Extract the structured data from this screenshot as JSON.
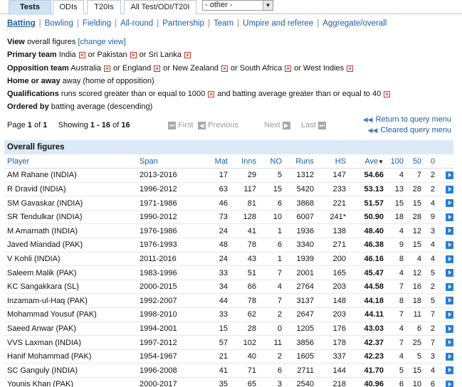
{
  "format_tabs": [
    "Tests",
    "ODIs",
    "T20Is",
    "All Test/ODI/T20I"
  ],
  "other_select": "- other -",
  "subnav": [
    "Batting",
    "Bowling",
    "Fielding",
    "All-round",
    "Partnership",
    "Team",
    "Umpire and referee",
    "Aggregate/overall"
  ],
  "view": {
    "label": "View",
    "value": "overall figures",
    "link": "[change view]"
  },
  "primary_team": {
    "label": "Primary team",
    "items": [
      "India",
      "or Pakistan",
      "or Sri Lanka"
    ]
  },
  "opposition_team": {
    "label": "Opposition team",
    "items": [
      "Australia",
      "or England",
      "or New Zealand",
      "or South Africa",
      "or West Indies"
    ]
  },
  "home_away": {
    "label": "Home or away",
    "value": "away (home of opposition)"
  },
  "qualifications": {
    "label": "Qualifications",
    "items": [
      "runs scored greater than or equal to 1000",
      "and batting average greater than or equal to 40"
    ]
  },
  "ordered_by": {
    "label": "Ordered by",
    "value": "batting average (descending)"
  },
  "paging": {
    "page_label": "Page",
    "page": "1",
    "of_label": "of",
    "pages": "1",
    "showing_label": "Showing",
    "range": "1 - 16",
    "total": "16",
    "first": "First",
    "previous": "Previous",
    "next": "Next",
    "last": "Last"
  },
  "right_links": {
    "return": "Return to query menu",
    "cleared": "Cleared query menu"
  },
  "table": {
    "caption": "Overall figures",
    "headers": [
      "Player",
      "Span",
      "Mat",
      "Inns",
      "NO",
      "Runs",
      "HS",
      "Ave",
      "100",
      "50",
      "0"
    ],
    "rows": [
      [
        "AM Rahane (INDIA)",
        "2013-2016",
        "17",
        "29",
        "5",
        "1312",
        "147",
        "54.66",
        "4",
        "7",
        "2"
      ],
      [
        "R Dravid (INDIA)",
        "1996-2012",
        "63",
        "117",
        "15",
        "5420",
        "233",
        "53.13",
        "13",
        "28",
        "2"
      ],
      [
        "SM Gavaskar (INDIA)",
        "1971-1986",
        "46",
        "81",
        "6",
        "3868",
        "221",
        "51.57",
        "15",
        "15",
        "4"
      ],
      [
        "SR Tendulkar (INDIA)",
        "1990-2012",
        "73",
        "128",
        "10",
        "6007",
        "241*",
        "50.90",
        "18",
        "28",
        "9"
      ],
      [
        "M Amarnath (INDIA)",
        "1976-1986",
        "24",
        "41",
        "1",
        "1936",
        "138",
        "48.40",
        "4",
        "12",
        "3"
      ],
      [
        "Javed Miandad (PAK)",
        "1976-1993",
        "48",
        "78",
        "6",
        "3340",
        "271",
        "46.38",
        "9",
        "15",
        "4"
      ],
      [
        "V Kohli (INDIA)",
        "2011-2016",
        "24",
        "43",
        "1",
        "1939",
        "200",
        "46.16",
        "8",
        "4",
        "4"
      ],
      [
        "Saleem Malik (PAK)",
        "1983-1996",
        "33",
        "51",
        "7",
        "2001",
        "165",
        "45.47",
        "4",
        "12",
        "5"
      ],
      [
        "KC Sangakkara (SL)",
        "2000-2015",
        "34",
        "66",
        "4",
        "2764",
        "203",
        "44.58",
        "7",
        "16",
        "2"
      ],
      [
        "Inzamam-ul-Haq (PAK)",
        "1992-2007",
        "44",
        "78",
        "7",
        "3137",
        "148",
        "44.18",
        "8",
        "18",
        "5"
      ],
      [
        "Mohammad Yousuf (PAK)",
        "1998-2010",
        "33",
        "62",
        "2",
        "2647",
        "203",
        "44.11",
        "7",
        "11",
        "7"
      ],
      [
        "Saeed Anwar (PAK)",
        "1994-2001",
        "15",
        "28",
        "0",
        "1205",
        "176",
        "43.03",
        "4",
        "6",
        "2"
      ],
      [
        "VVS Laxman (INDIA)",
        "1997-2012",
        "57",
        "102",
        "11",
        "3856",
        "178",
        "42.37",
        "7",
        "25",
        "7"
      ],
      [
        "Hanif Mohammad (PAK)",
        "1954-1967",
        "21",
        "40",
        "2",
        "1605",
        "337",
        "42.23",
        "4",
        "5",
        "3"
      ],
      [
        "SC Ganguly (INDIA)",
        "1996-2008",
        "41",
        "71",
        "6",
        "2711",
        "144",
        "41.70",
        "5",
        "15",
        "4"
      ],
      [
        "Younis Khan (PAK)",
        "2000-2017",
        "35",
        "65",
        "3",
        "2540",
        "218",
        "40.96",
        "6",
        "10",
        "6"
      ]
    ]
  },
  "colors": {
    "link": "#1c5ea8",
    "tab_active": "#cfe3f5",
    "caption_bg": "#dceaf7",
    "row_button": "#2a7fd4",
    "remove": "#c0392b"
  }
}
